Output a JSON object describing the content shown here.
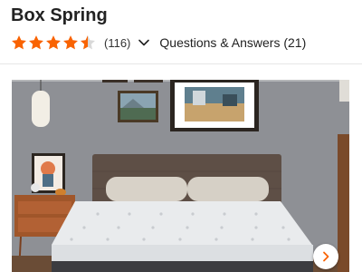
{
  "product": {
    "title": "Box Spring"
  },
  "rating": {
    "value": 4.5,
    "max": 5,
    "count_text": "(116)"
  },
  "qa": {
    "label": "Questions & Answers (21)"
  },
  "colors": {
    "star": "#f96302",
    "star_empty": "#d9d9d9"
  },
  "icons": {
    "star": "star-icon",
    "chevron": "chevron-down-icon",
    "next": "chevron-right-icon"
  }
}
